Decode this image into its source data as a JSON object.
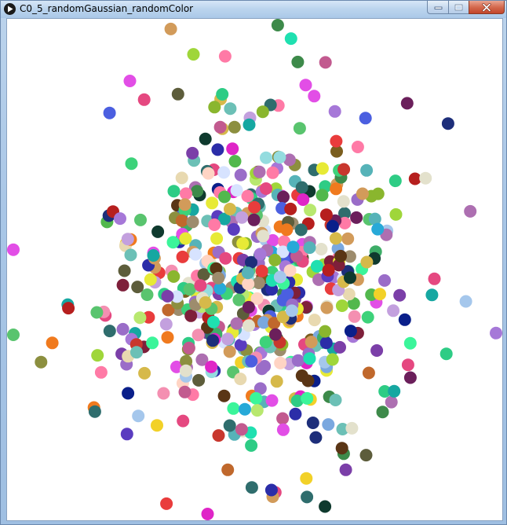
{
  "window": {
    "title": "C0_5_randomGaussian_randomColor",
    "app_icon": "play-icon",
    "controls": [
      "minimize-icon",
      "maximize-icon",
      "close-icon"
    ]
  },
  "sketch": {
    "background": "#ffffff",
    "shape": "circle",
    "note": "random circles, gaussian distributed positions with random colors",
    "palette": [
      "#e54880",
      "#7b3fa8",
      "#2ecc85",
      "#8c8f3f",
      "#9a6dc8",
      "#3d8a4a",
      "#d6b94a",
      "#1d2e7a",
      "#c8372e",
      "#27a9d8",
      "#f07a1e",
      "#5a3515",
      "#b61f1e",
      "#f2d128",
      "#3dd27a",
      "#a678d8",
      "#e3e1cc",
      "#4b5fe0",
      "#df25c7",
      "#0f3a2e",
      "#7aa8df",
      "#9fd63a",
      "#0a1f8a",
      "#ad6fb1",
      "#e8d9b0",
      "#6cc0b6",
      "#d29b5a",
      "#7e1f3a",
      "#2b2da8",
      "#94dcdf",
      "#52b84d",
      "#c3a0de",
      "#3bf59a",
      "#2f6d6d",
      "#7b5e1e",
      "#e93c3c",
      "#59c46e",
      "#a5c7ec",
      "#f48fb1",
      "#c0682c",
      "#b8e86f",
      "#1fe0b0",
      "#6b1f5b",
      "#e7ea36",
      "#d7e3ff",
      "#3dad67",
      "#c25a8f",
      "#5d5d3b",
      "#ffd4c4",
      "#8ab62e",
      "#16a7a1",
      "#ff7aa6",
      "#5a3cc0",
      "#9d8c6d",
      "#e24ee6",
      "#56b3b8"
    ]
  }
}
